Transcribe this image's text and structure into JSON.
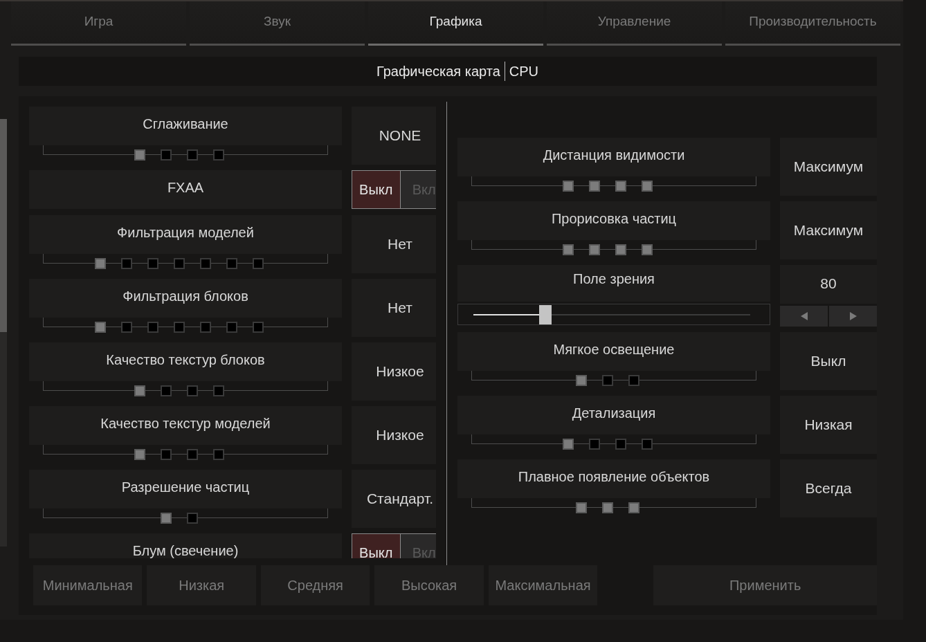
{
  "tabs": [
    {
      "label": "Игра",
      "selected": false
    },
    {
      "label": "Звук",
      "selected": false
    },
    {
      "label": "Графика",
      "selected": true
    },
    {
      "label": "Управление",
      "selected": false
    },
    {
      "label": "Производительность",
      "selected": false
    }
  ],
  "sections": [
    "Графическая карта",
    "CPU"
  ],
  "left_settings": [
    {
      "kind": "steps",
      "label": "Сглаживание",
      "value": "NONE",
      "notches": [
        {
          "filled": true
        },
        {
          "filled": false
        },
        {
          "filled": false
        },
        {
          "filled": false
        }
      ]
    },
    {
      "kind": "toggle",
      "label": "FXAA",
      "options": [
        {
          "label": "Выкл",
          "selected": true
        },
        {
          "label": "Вкл",
          "selected": false
        }
      ]
    },
    {
      "kind": "steps",
      "label": "Фильтрация моделей",
      "value": "Нет",
      "notches": [
        {
          "filled": true
        },
        {
          "filled": false
        },
        {
          "filled": false
        },
        {
          "filled": false
        },
        {
          "filled": false
        },
        {
          "filled": false
        },
        {
          "filled": false
        }
      ]
    },
    {
      "kind": "steps",
      "label": "Фильтрация блоков",
      "value": "Нет",
      "notches": [
        {
          "filled": true
        },
        {
          "filled": false
        },
        {
          "filled": false
        },
        {
          "filled": false
        },
        {
          "filled": false
        },
        {
          "filled": false
        },
        {
          "filled": false
        }
      ]
    },
    {
      "kind": "steps",
      "label": "Качество текстур блоков",
      "value": "Низкое",
      "notches": [
        {
          "filled": true
        },
        {
          "filled": false
        },
        {
          "filled": false
        },
        {
          "filled": false
        }
      ]
    },
    {
      "kind": "steps",
      "label": "Качество текстур моделей",
      "value": "Низкое",
      "notches": [
        {
          "filled": true
        },
        {
          "filled": false
        },
        {
          "filled": false
        },
        {
          "filled": false
        }
      ]
    },
    {
      "kind": "steps",
      "label": "Разрешение частиц",
      "value": "Стандарт.",
      "notches": [
        {
          "filled": true
        },
        {
          "filled": false
        }
      ]
    },
    {
      "kind": "toggle",
      "label": "Блум (свечение)",
      "options": [
        {
          "label": "Выкл",
          "selected": true
        },
        {
          "label": "Вкл",
          "selected": false
        }
      ]
    }
  ],
  "right_settings": [
    {
      "kind": "steps",
      "label": "Дистанция видимости",
      "value": "Максимум",
      "notches": [
        {
          "filled": true
        },
        {
          "filled": true
        },
        {
          "filled": true
        },
        {
          "filled": true
        }
      ]
    },
    {
      "kind": "steps",
      "label": "Прорисовка частиц",
      "value": "Максимум",
      "notches": [
        {
          "filled": true
        },
        {
          "filled": true
        },
        {
          "filled": true
        },
        {
          "filled": true
        }
      ]
    },
    {
      "kind": "slider",
      "label": "Поле зрения",
      "value": "80",
      "level": 0.26
    },
    {
      "kind": "steps",
      "label": "Мягкое освещение",
      "value": "Выкл",
      "notches": [
        {
          "filled": true
        },
        {
          "filled": false
        },
        {
          "filled": false
        }
      ]
    },
    {
      "kind": "steps",
      "label": "Детализация",
      "value": "Низкая",
      "notches": [
        {
          "filled": true
        },
        {
          "filled": false
        },
        {
          "filled": false
        },
        {
          "filled": false
        }
      ]
    },
    {
      "kind": "steps",
      "label": "Плавное появление объектов",
      "value": "Всегда",
      "notches": [
        {
          "filled": true
        },
        {
          "filled": true
        },
        {
          "filled": true
        }
      ]
    }
  ],
  "presets": [
    "Минимальная",
    "Низкая",
    "Средняя",
    "Высокая",
    "Максимальная"
  ],
  "apply_button": "Применить"
}
